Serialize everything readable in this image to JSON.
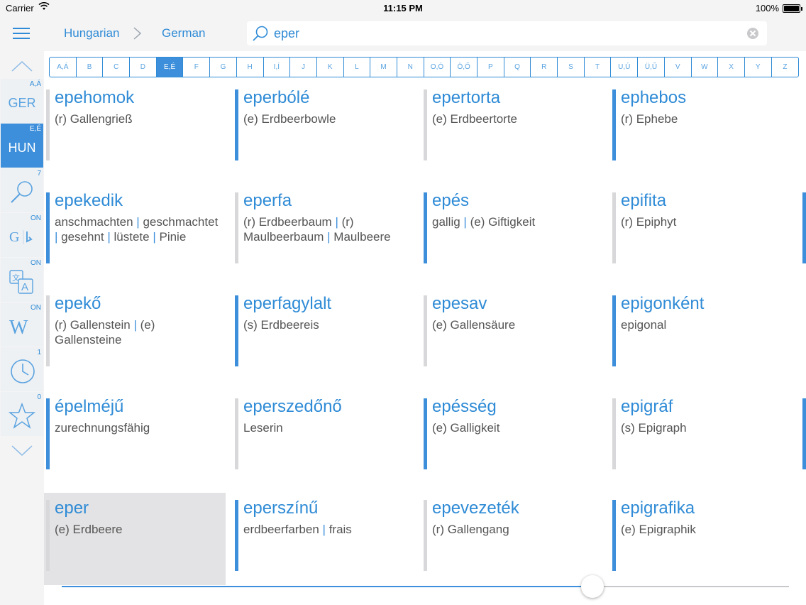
{
  "status_bar": {
    "carrier": "Carrier",
    "time": "11:15 PM",
    "battery": "100%",
    "battery_level": 1.0
  },
  "nav": {
    "source_language": "Hungarian",
    "target_language": "German",
    "search_query": "eper"
  },
  "sidebar": {
    "items": [
      {
        "label": "GER",
        "badge": "A,Á",
        "icon": ""
      },
      {
        "label": "HUN",
        "badge": "E,É",
        "icon": "",
        "active": true
      },
      {
        "label": "",
        "badge": "7",
        "icon": "search-icon"
      },
      {
        "label": "",
        "badge": "ON",
        "icon": "google-bing-icon"
      },
      {
        "label": "",
        "badge": "ON",
        "icon": "translate-icon"
      },
      {
        "label": "",
        "badge": "ON",
        "icon": "wikipedia-icon"
      },
      {
        "label": "",
        "badge": "1",
        "icon": "history-clock-icon"
      },
      {
        "label": "",
        "badge": "0",
        "icon": "star-icon"
      }
    ]
  },
  "alphabet": [
    "A,Á",
    "B",
    "C",
    "D",
    "E,É",
    "F",
    "G",
    "H",
    "I,Í",
    "J",
    "K",
    "L",
    "M",
    "N",
    "O,Ó",
    "Ö,Ő",
    "P",
    "Q",
    "R",
    "S",
    "T",
    "U,Ú",
    "Ü,Ű",
    "V",
    "W",
    "X",
    "Y",
    "Z"
  ],
  "alphabet_selected": "E,É",
  "entries": [
    {
      "word": "epehomok",
      "translation": "(r) Gallengrieß",
      "mark": "gray"
    },
    {
      "word": "eperbólé",
      "translation": "(e) Erdbeerbowle",
      "mark": "blue"
    },
    {
      "word": "epertorta",
      "translation": "(e) Erdbeertorte",
      "mark": "gray"
    },
    {
      "word": "ephebos",
      "translation": "(r) Ephebe",
      "mark": "blue"
    },
    {
      "word": "epekedik",
      "translation": "anschmachten | geschmachtet | gesehnt | lüstete | Pinie",
      "mark": "blue"
    },
    {
      "word": "eperfa",
      "translation": "(r) Erdbeerbaum | (r) Maulbeerbaum | Maulbeere",
      "mark": "gray"
    },
    {
      "word": "epés",
      "translation": "gallig | (e) Giftigkeit",
      "mark": "blue"
    },
    {
      "word": "epifita",
      "translation": "(r) Epiphyt",
      "mark": "gray"
    },
    {
      "word": "epekő",
      "translation": "(r) Gallenstein | (e) Gallensteine",
      "mark": "gray"
    },
    {
      "word": "eperfagylalt",
      "translation": "(s) Erdbeereis",
      "mark": "blue"
    },
    {
      "word": "epesav",
      "translation": "(e) Gallensäure",
      "mark": "gray"
    },
    {
      "word": "epigonként",
      "translation": "epigonal",
      "mark": "blue"
    },
    {
      "word": "épelméjű",
      "translation": "zurechnungsfähig",
      "mark": "blue"
    },
    {
      "word": "eperszedőnő",
      "translation": "Leserin",
      "mark": "gray"
    },
    {
      "word": "epésség",
      "translation": "(e) Galligkeit",
      "mark": "blue"
    },
    {
      "word": "epigráf",
      "translation": "(s) Epigraph",
      "mark": "gray"
    },
    {
      "word": "eper",
      "translation": "(e) Erdbeere",
      "mark": "gray",
      "selected": true
    },
    {
      "word": "eperszínű",
      "translation": "erdbeerfarben | frais",
      "mark": "blue"
    },
    {
      "word": "epevezeték",
      "translation": "(r) Gallengang",
      "mark": "gray"
    },
    {
      "word": "epigrafika",
      "translation": "(e) Epigraphik",
      "mark": "blue"
    }
  ],
  "slider": {
    "position": 0.73
  },
  "colors": {
    "accent": "#3d8fdb",
    "link": "#2f8bd6",
    "gray_mark": "#d8d8da",
    "sidebar_bg": "#f4f4f5"
  }
}
